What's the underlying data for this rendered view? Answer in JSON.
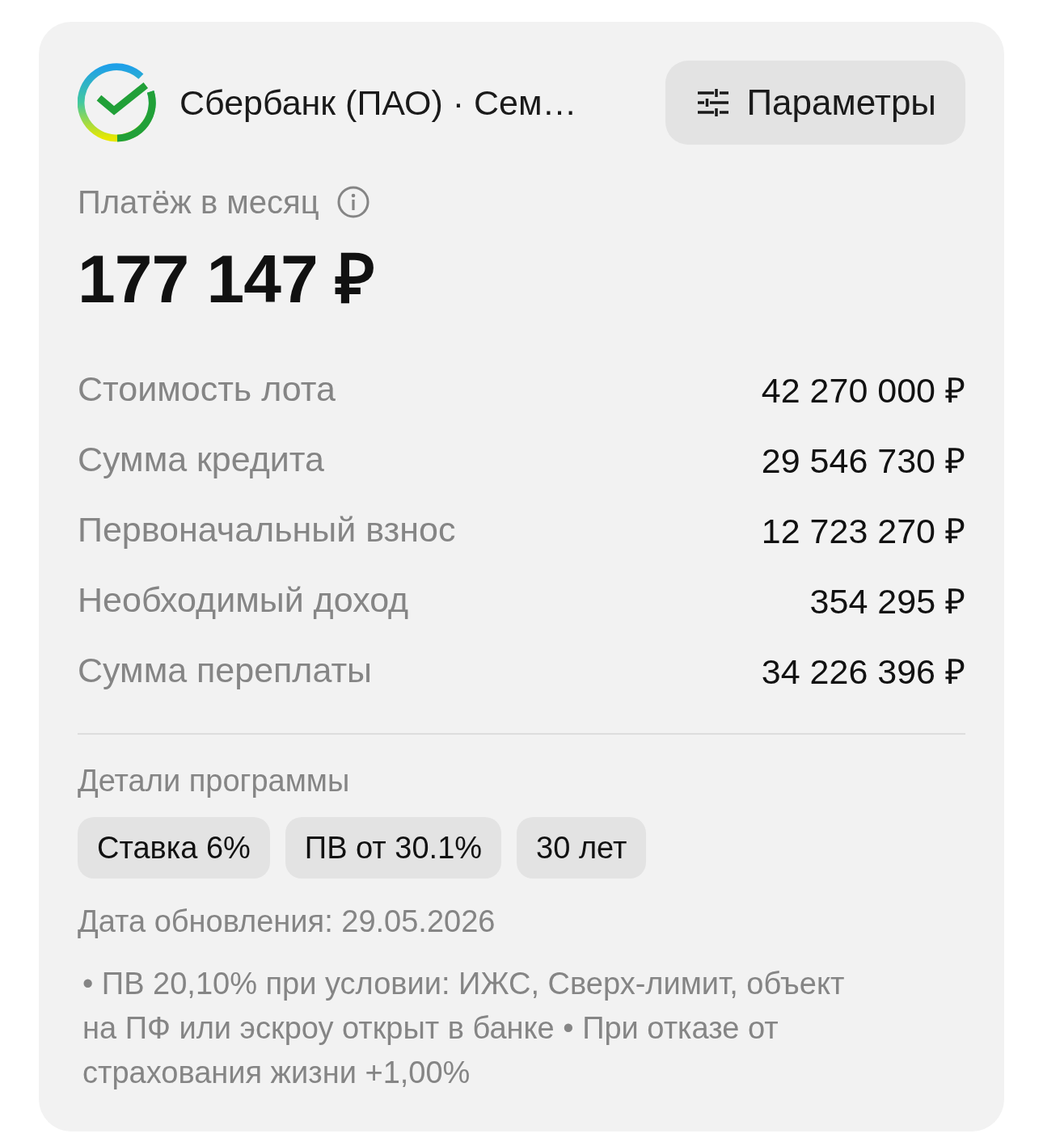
{
  "header": {
    "title": "Сбербанк (ПАО) · Сем…",
    "params_button": {
      "label": "Параметры"
    }
  },
  "payment": {
    "label": "Платёж в месяц",
    "amount": "177 147 ₽"
  },
  "rows": [
    {
      "label": "Стоимость лота",
      "value": "42 270 000 ₽"
    },
    {
      "label": "Сумма кредита",
      "value": "29 546 730 ₽"
    },
    {
      "label": "Первоначальный взнос",
      "value": "12 723 270 ₽"
    },
    {
      "label": "Необходимый доход",
      "value": "354 295 ₽"
    },
    {
      "label": "Сумма переплаты",
      "value": "34 226 396 ₽"
    }
  ],
  "program": {
    "title": "Детали программы",
    "tags": [
      "Ставка 6%",
      "ПВ от 30.1%",
      "30 лет"
    ]
  },
  "updated": "Дата обновления: 29.05.2026",
  "notes": "• ПВ 20,10% при условии: ИЖС, Сверх-лимит, объект на ПФ или эскроу открыт в банке • При отказе от страхования жизни +1,00%"
}
